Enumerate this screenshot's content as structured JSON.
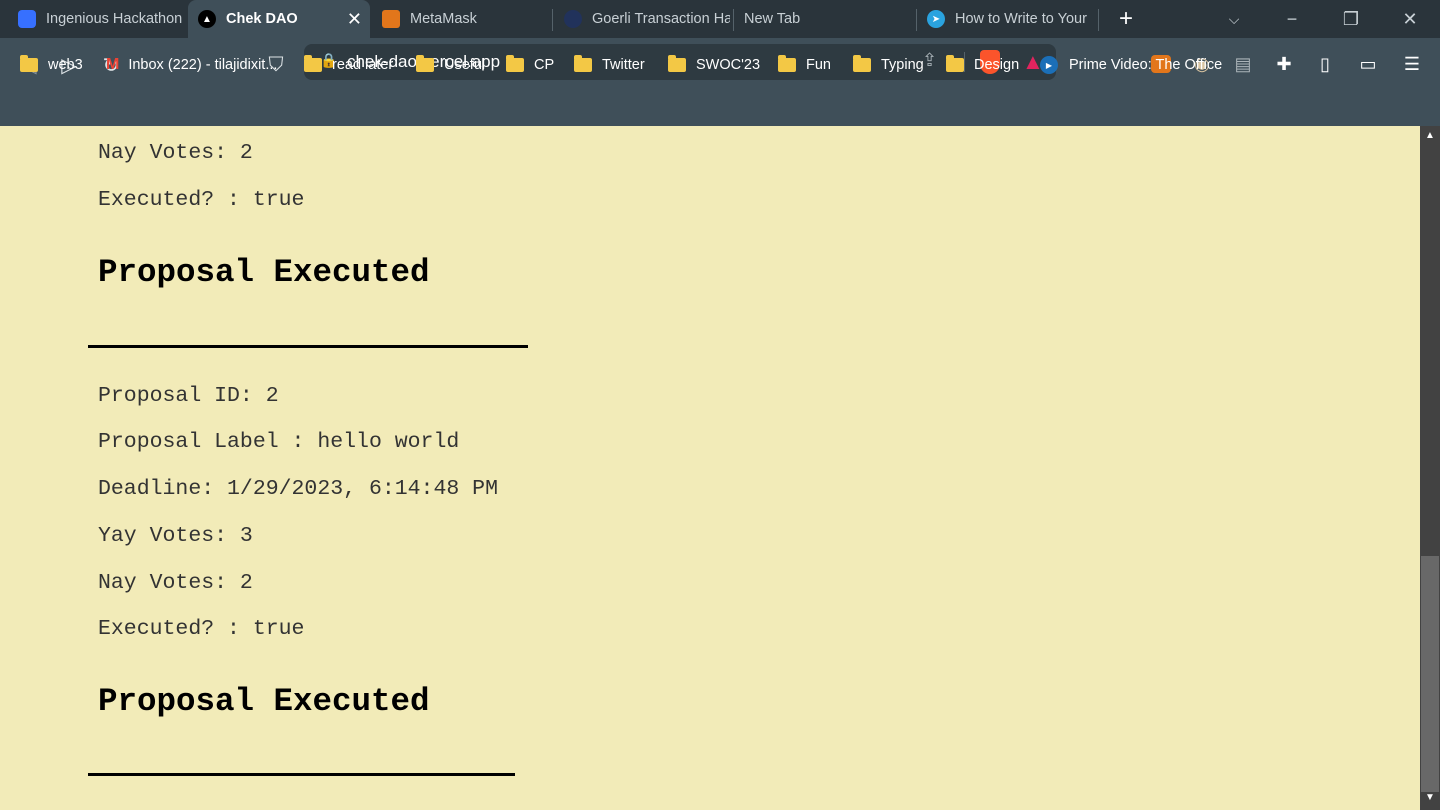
{
  "browser": {
    "tabs": [
      {
        "label": "Ingenious Hackathon",
        "icon": "devfolio-icon",
        "active": false
      },
      {
        "label": "Chek DAO",
        "icon": "vercel-icon",
        "active": true
      },
      {
        "label": "MetaMask",
        "icon": "metamask-icon",
        "active": false
      },
      {
        "label": "Goerli Transaction Ha",
        "icon": "etherscan-icon",
        "active": false
      },
      {
        "label": "New Tab",
        "icon": "",
        "active": false
      },
      {
        "label": "How to Write to Your",
        "icon": "telegram-icon",
        "active": false
      }
    ],
    "url": "chek-dao.vercel.app",
    "bookmarks": [
      {
        "label": "web3",
        "icon": "folder-icon"
      },
      {
        "label": "Inbox (222) - tilajidixit...",
        "icon": "gmail-icon"
      },
      {
        "label": "read later",
        "icon": "folder-icon"
      },
      {
        "label": "Useful",
        "icon": "folder-icon"
      },
      {
        "label": "CP",
        "icon": "folder-icon"
      },
      {
        "label": "Twitter",
        "icon": "folder-icon"
      },
      {
        "label": "SWOC'23",
        "icon": "folder-icon"
      },
      {
        "label": "Fun",
        "icon": "folder-icon"
      },
      {
        "label": "Typing",
        "icon": "folder-icon"
      },
      {
        "label": "Design",
        "icon": "folder-icon"
      },
      {
        "label": "Prime Video: The Office",
        "icon": "prime-video-icon"
      }
    ]
  },
  "page": {
    "top": {
      "nay": "Nay Votes: 2",
      "executed": "Executed? : true",
      "status": "Proposal Executed"
    },
    "proposal": {
      "id": "Proposal ID: 2",
      "label": "Proposal Label : hello world",
      "deadline": "Deadline: 1/29/2023, 6:14:48 PM",
      "yay": "Yay Votes: 3",
      "nay": "Nay Votes: 2",
      "executed": "Executed? : true",
      "status": "Proposal Executed"
    }
  },
  "colors": {
    "page_bg": "#f2ebb8",
    "toolbar": "#3f4f59",
    "tabbar": "#2a343b"
  }
}
